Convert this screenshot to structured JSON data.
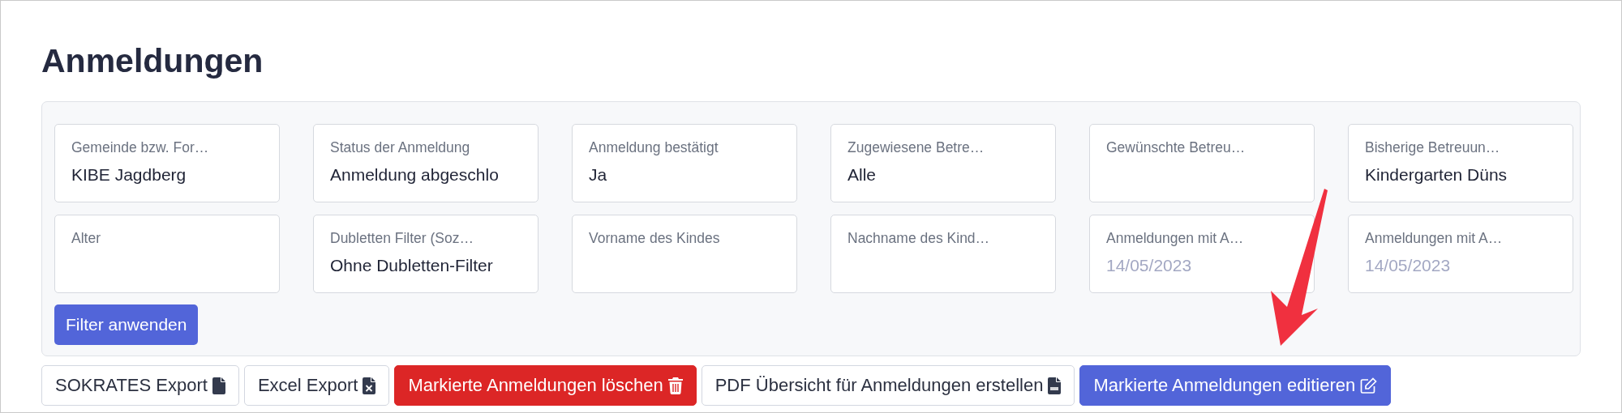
{
  "title": "Anmeldungen",
  "filters": [
    {
      "label": "Gemeinde bzw. For…",
      "value": "KIBE Jagdberg"
    },
    {
      "label": "Status der Anmeldung",
      "value": "Anmeldung abgeschlo"
    },
    {
      "label": "Anmeldung bestätigt",
      "value": "Ja"
    },
    {
      "label": "Zugewiesene Betre…",
      "value": "Alle"
    },
    {
      "label": "Gewünschte Betreu…"
    },
    {
      "label": "Bisherige Betreuun…",
      "value": "Kindergarten Düns"
    },
    {
      "label": "Alter"
    },
    {
      "label": "Dubletten Filter (Soz…",
      "value": "Ohne Dubletten-Filter"
    },
    {
      "label": "Vorname des Kindes"
    },
    {
      "label": "Nachname des Kind…"
    },
    {
      "label": "Anmeldungen mit A…",
      "placeholder": "14/05/2023"
    },
    {
      "label": "Anmeldungen mit A…",
      "placeholder": "14/05/2023"
    }
  ],
  "apply_button": "Filter anwenden",
  "actions": [
    {
      "label": "SOKRATES Export",
      "kind": "default"
    },
    {
      "label": "Excel Export",
      "kind": "default"
    },
    {
      "label": "Markierte Anmeldungen löschen",
      "kind": "danger"
    },
    {
      "label": "PDF Übersicht für Anmeldungen erstellen",
      "kind": "default"
    },
    {
      "label": "Markierte Anmeldungen editieren",
      "kind": "primary"
    }
  ]
}
